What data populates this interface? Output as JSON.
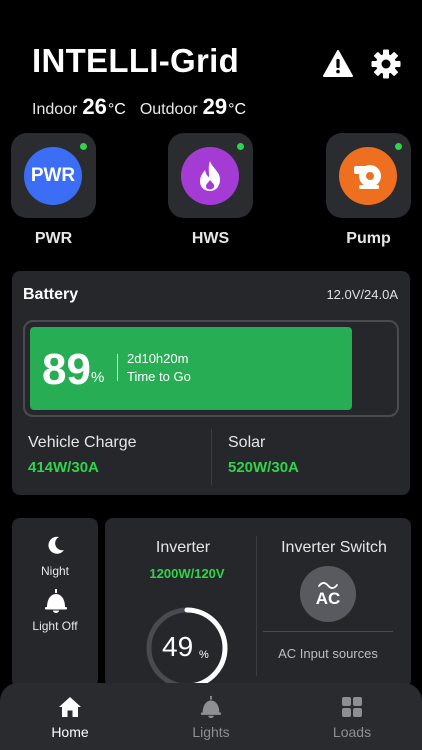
{
  "header": {
    "title": "INTELLI-Grid",
    "indoor_label": "Indoor",
    "indoor_value": "26",
    "indoor_unit": "°C",
    "outdoor_label": "Outdoor",
    "outdoor_value": "29",
    "outdoor_unit": "°C",
    "icons": [
      "warning-icon",
      "gear-icon"
    ]
  },
  "quick_tiles": [
    {
      "label": "PWR",
      "badge_text": "PWR",
      "color": "#3b6ef5",
      "icon": "pwr-text-icon",
      "status_dot": "#2fd44a"
    },
    {
      "label": "HWS",
      "color": "#a33bd4",
      "icon": "flame-icon",
      "status_dot": "#2fd44a"
    },
    {
      "label": "Pump",
      "color": "#ee6f20",
      "icon": "pump-icon",
      "status_dot": "#2fd44a"
    }
  ],
  "battery": {
    "title": "Battery",
    "rating": "12.0V/24.0A",
    "level_percent": 89,
    "percent_value": "89",
    "percent_sign": "%",
    "time_to_go": "2d10h20m",
    "time_to_go_label": "Time to Go",
    "fill_color": "#27ae55"
  },
  "stats": {
    "vehicle_charge_label": "Vehicle Charge",
    "vehicle_charge_value": "414W/30A",
    "solar_label": "Solar",
    "solar_value": "520W/30A",
    "accent_color": "#2fd44a"
  },
  "side_panel": {
    "night_label": "Night",
    "night_icon": "moon-icon",
    "light_label": "Light Off",
    "light_icon": "lamp-icon"
  },
  "inverter": {
    "title": "Inverter",
    "value": "1200W/120V",
    "gauge_percent": 49,
    "gauge_value": "49",
    "gauge_unit": "%",
    "switch_title": "Inverter Switch",
    "switch_label": "AC",
    "ac_sources_label": "AC Input sources"
  },
  "tabbar": {
    "items": [
      {
        "label": "Home",
        "icon": "home-icon",
        "active": true
      },
      {
        "label": "Lights",
        "icon": "lamp-icon",
        "active": false
      },
      {
        "label": "Loads",
        "icon": "grid-icon",
        "active": false
      }
    ]
  }
}
